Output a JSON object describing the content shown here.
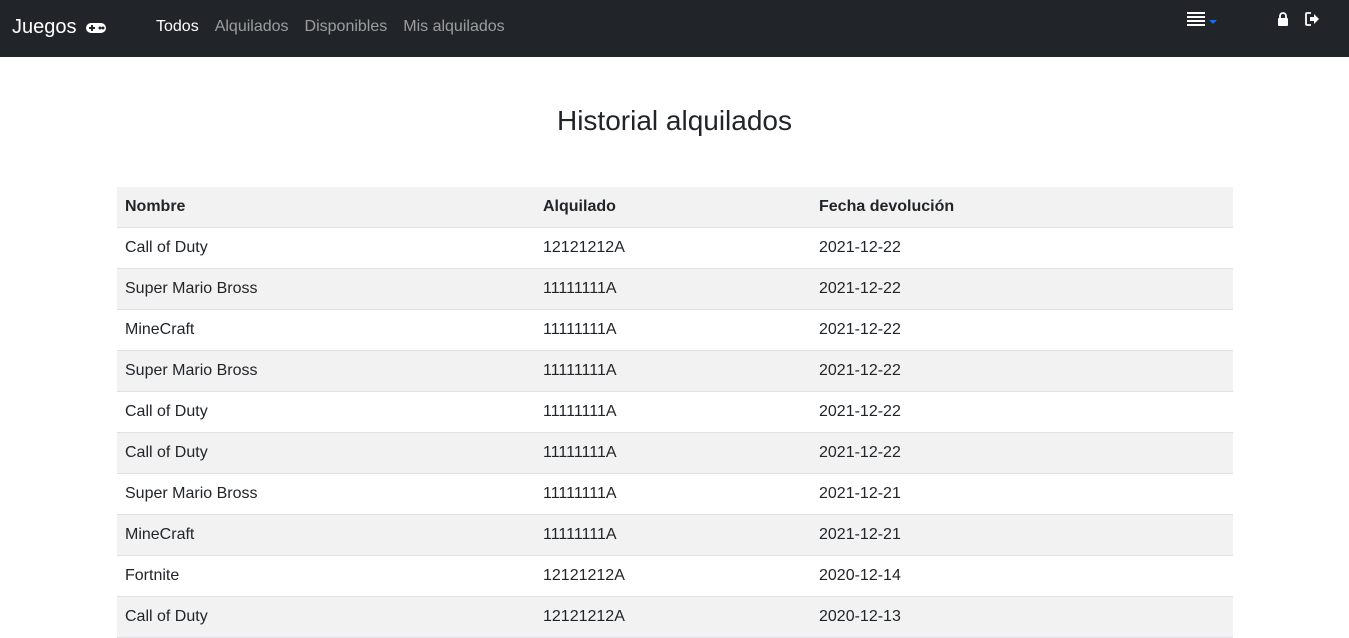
{
  "navbar": {
    "brand": "Juegos",
    "brand_icon": "gamepad-icon",
    "links": [
      {
        "label": "Todos",
        "active": true
      },
      {
        "label": "Alquilados",
        "active": false
      },
      {
        "label": "Disponibles",
        "active": false
      },
      {
        "label": "Mis alquilados",
        "active": false
      }
    ],
    "menu_icon": "list-icon",
    "lock_icon": "lock-icon",
    "logout_icon": "sign-out-icon",
    "accent_color": "#0d6efd",
    "bg_color": "#212529"
  },
  "main": {
    "title": "Historial alquilados",
    "table": {
      "headers": [
        "Nombre",
        "Alquilado",
        "Fecha devolución"
      ],
      "rows": [
        [
          "Call of Duty",
          "12121212A",
          "2021-12-22"
        ],
        [
          "Super Mario Bross",
          "11111111A",
          "2021-12-22"
        ],
        [
          "MineCraft",
          "11111111A",
          "2021-12-22"
        ],
        [
          "Super Mario Bross",
          "11111111A",
          "2021-12-22"
        ],
        [
          "Call of Duty",
          "11111111A",
          "2021-12-22"
        ],
        [
          "Call of Duty",
          "11111111A",
          "2021-12-22"
        ],
        [
          "Super Mario Bross",
          "11111111A",
          "2021-12-21"
        ],
        [
          "MineCraft",
          "11111111A",
          "2021-12-21"
        ],
        [
          "Fortnite",
          "12121212A",
          "2020-12-14"
        ],
        [
          "Call of Duty",
          "12121212A",
          "2020-12-13"
        ]
      ]
    }
  }
}
